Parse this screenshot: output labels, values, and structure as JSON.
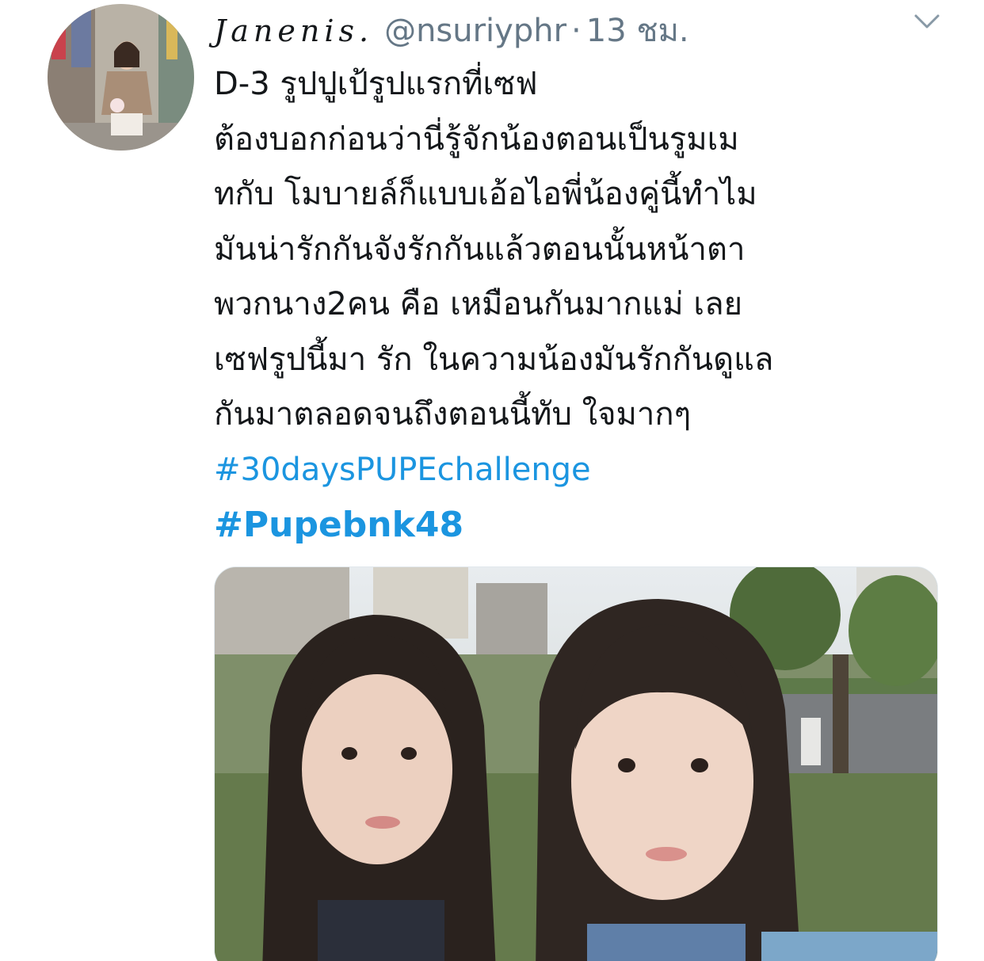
{
  "tweet": {
    "display_name": "Janenis.",
    "handle": "@nsuriyphr",
    "separator": "·",
    "time": "13 ชม.",
    "more_icon": "chevron-down-icon",
    "avatar_icon": "user-avatar-photo",
    "lines": [
      "D-3 รูปปูเป้รูปแรกที่เซฟ",
      "ต้องบอกก่อนว่านี่รู้จักน้องตอนเป็นรูมเม",
      "ทกับ โมบายล์ก็แบบเอ้อไอพี่น้องคู่นี้ทำไม",
      "มันน่ารักกันจังรักกันแล้วตอนนั้นหน้าตา",
      "พวกนาง2คน คือ เหมือนกันมากแม่ เลย",
      "เซฟรูปนี้มา รัก ในความน้องมันรักกันดูแล",
      "กันมาตลอดจนถึงตอนนี้ทับ ใจมากๆ"
    ],
    "hashtags": [
      "#30daysPUPEchallenge",
      "#Pupebnk48"
    ],
    "colors": {
      "text": "#14171a",
      "secondary": "#657786",
      "link": "#1b95e0"
    }
  }
}
